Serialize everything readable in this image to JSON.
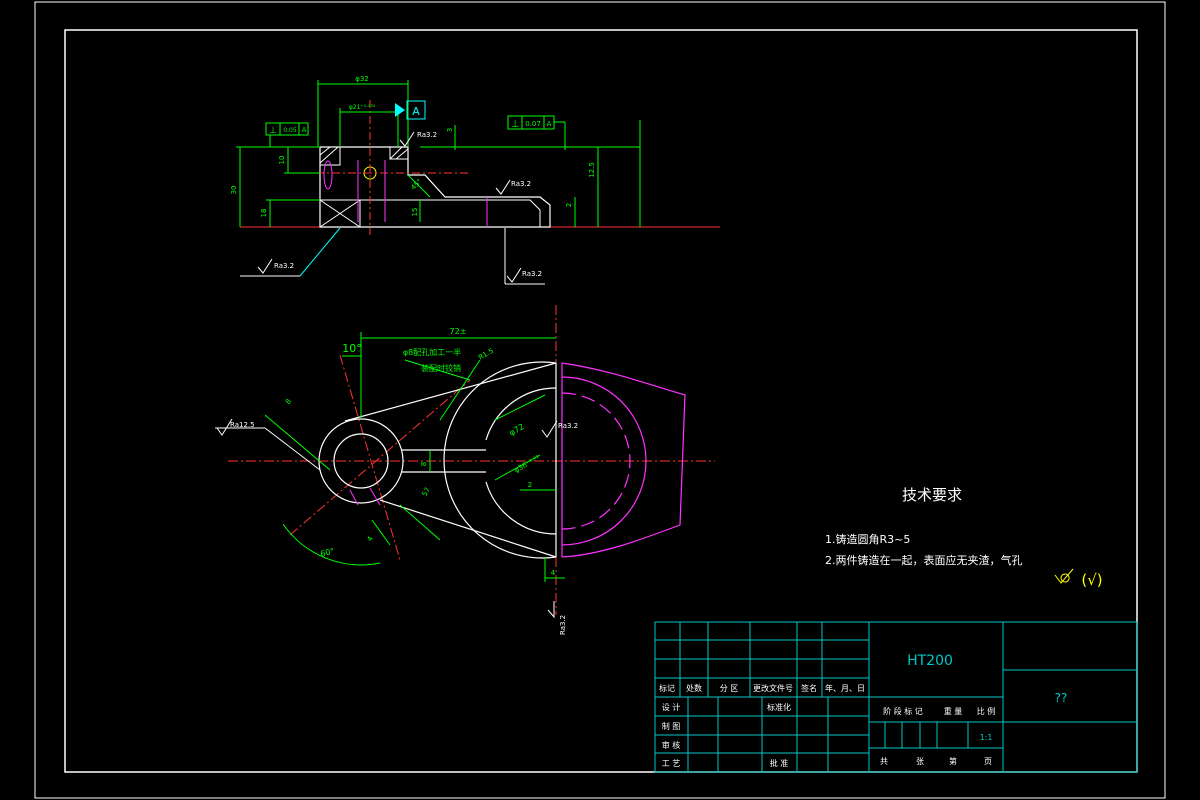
{
  "colors": {
    "background": "#000000",
    "frame": "#ffffff",
    "table_lines": "#00c8c8",
    "dimension": "#00ff00",
    "outline": "#ffffff",
    "hidden": "#ff33ff",
    "centerline": "#ff3333",
    "ref_line": "#00ffff"
  },
  "top_view": {
    "dims": {
      "width_overall": "φ32",
      "bore": "φ21⁺⁰·⁰³³",
      "datum": "A",
      "height": "30",
      "h10": "10",
      "h18": "18",
      "v3": "3",
      "v2": "2",
      "v15": "15",
      "tall": "12.5",
      "chamfer": "45°"
    },
    "tolerance_left": {
      "symbol": "⊥",
      "value": "0.05",
      "datum": "A"
    },
    "tolerance_right": {
      "symbol": "⊥",
      "value": "0.07",
      "datum": "A"
    },
    "roughness": [
      "Ra3.2",
      "Ra3.2",
      "Ra3.2",
      "Ra3.2"
    ]
  },
  "front_view": {
    "dims": {
      "length": "72±",
      "angle10": "10°",
      "hole_note_1": "φ8配孔加工一半",
      "hole_note_2": "装配时铰销",
      "r_fillet": "R1.5",
      "r72": "φ72",
      "r36": "φ36⁺⁰·⁰³",
      "d8": "8",
      "d2": "2",
      "d57": "57",
      "angle60": "60°",
      "w4": "4",
      "bottom_4": "4"
    },
    "roughness": [
      "Ra12.5",
      "Ra3.2",
      "Ra3.2"
    ]
  },
  "tech_requirements": {
    "title": "技术要求",
    "items": [
      "1.铸造圆角R3~5",
      "2.两件铸造在一起，表面应无夹渣，气孔"
    ],
    "roughness_symbol": "(√)"
  },
  "title_block": {
    "material": "HT200",
    "name": "??",
    "row_labels": [
      "标记",
      "处数",
      "分  区",
      "更改文件号",
      "签名",
      "年、月、日"
    ],
    "side_labels": [
      "设  计",
      "制  图",
      "审  核",
      "工  艺"
    ],
    "standardize": "标准化",
    "approve": "批  准",
    "stage_labels": [
      "阶  段  标  记",
      "重  量",
      "比  例"
    ],
    "scale": "1:1",
    "sheet_labels": [
      "共",
      "张",
      "第",
      "页"
    ]
  }
}
